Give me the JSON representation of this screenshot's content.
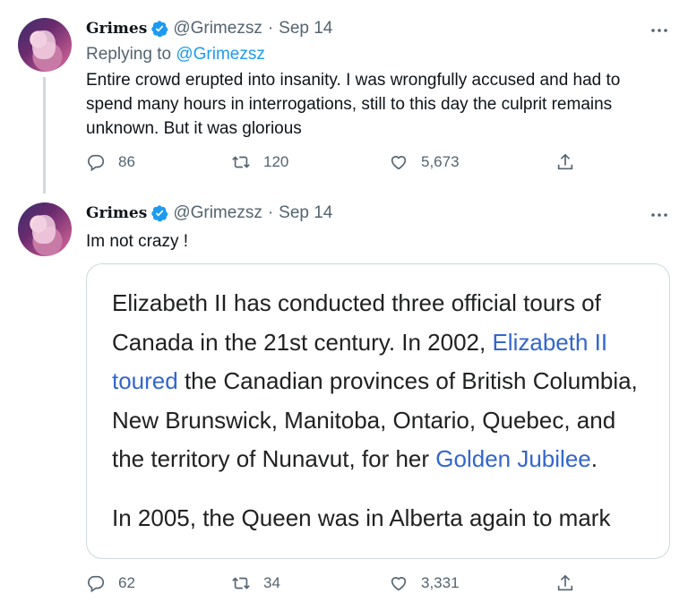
{
  "tweet1": {
    "name": "Grimes",
    "handle": "@Grimezsz",
    "date": "Sep 14",
    "replying_label": "Replying to",
    "replying_handle": "@Grimezsz",
    "text": "Entire crowd erupted into insanity.  I was wrongfully accused and had to spend many hours in interrogations, still to this day the culprit remains unknown.  But it was glorious",
    "replies": "86",
    "retweets": "120",
    "likes": "5,673"
  },
  "tweet2": {
    "name": "Grimes",
    "handle": "@Grimezsz",
    "date": "Sep 14",
    "text": "Im not crazy !",
    "card": {
      "p1_a": "Elizabeth II has conducted three official tours of Canada in the 21st century. In 2002, ",
      "p1_link1": "Elizabeth II toured",
      "p1_b": " the Canadian provinces of British Columbia, New Brunswick, Manitoba, Ontario, Quebec, and the territory of Nunavut, for her ",
      "p1_link2": "Golden Jubilee",
      "p1_c": ".",
      "p2": "In 2005, the Queen was in Alberta again to mark"
    },
    "replies": "62",
    "retweets": "34",
    "likes": "3,331"
  },
  "separator": "·",
  "icons": {
    "verified": "verified-badge-icon",
    "more": "more-options-icon",
    "reply": "reply-icon",
    "retweet": "retweet-icon",
    "like": "heart-icon",
    "share": "share-icon"
  },
  "colors": {
    "link": "#1d9bf0",
    "muted": "#536471",
    "wiki_link": "#3366cc"
  }
}
